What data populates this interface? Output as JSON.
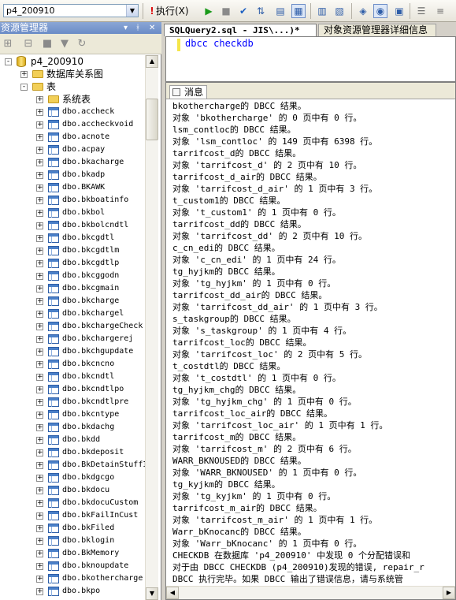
{
  "toolbar": {
    "database": "p4_200910",
    "execute_label": "执行(X)"
  },
  "object_explorer": {
    "title": "资源管理器",
    "pin": "▾ ╀ ✕",
    "nodes": [
      {
        "label": "p4_200910",
        "level": 0,
        "kind": "db",
        "exp": "-"
      },
      {
        "label": "数据库关系图",
        "level": 1,
        "kind": "folder",
        "exp": "+"
      },
      {
        "label": "表",
        "level": 1,
        "kind": "folder",
        "exp": "-"
      },
      {
        "label": "系统表",
        "level": 2,
        "kind": "folder",
        "exp": "+"
      },
      {
        "label": "dbo.accheck",
        "level": 2,
        "kind": "table",
        "exp": "+"
      },
      {
        "label": "dbo.accheckvoid",
        "level": 2,
        "kind": "table",
        "exp": "+"
      },
      {
        "label": "dbo.acnote",
        "level": 2,
        "kind": "table",
        "exp": "+"
      },
      {
        "label": "dbo.acpay",
        "level": 2,
        "kind": "table",
        "exp": "+"
      },
      {
        "label": "dbo.bkacharge",
        "level": 2,
        "kind": "table",
        "exp": "+"
      },
      {
        "label": "dbo.bkadp",
        "level": 2,
        "kind": "table",
        "exp": "+"
      },
      {
        "label": "dbo.BKAWK",
        "level": 2,
        "kind": "table",
        "exp": "+"
      },
      {
        "label": "dbo.bkboatinfo",
        "level": 2,
        "kind": "table",
        "exp": "+"
      },
      {
        "label": "dbo.bkbol",
        "level": 2,
        "kind": "table",
        "exp": "+"
      },
      {
        "label": "dbo.bkbolcndtl",
        "level": 2,
        "kind": "table",
        "exp": "+"
      },
      {
        "label": "dbo.bkcgdtl",
        "level": 2,
        "kind": "table",
        "exp": "+"
      },
      {
        "label": "dbo.bkcgdtlm",
        "level": 2,
        "kind": "table",
        "exp": "+"
      },
      {
        "label": "dbo.bkcgdtlp",
        "level": 2,
        "kind": "table",
        "exp": "+"
      },
      {
        "label": "dbo.bkcggodn",
        "level": 2,
        "kind": "table",
        "exp": "+"
      },
      {
        "label": "dbo.bkcgmain",
        "level": 2,
        "kind": "table",
        "exp": "+"
      },
      {
        "label": "dbo.bkcharge",
        "level": 2,
        "kind": "table",
        "exp": "+"
      },
      {
        "label": "dbo.bkchargel",
        "level": 2,
        "kind": "table",
        "exp": "+"
      },
      {
        "label": "dbo.bkchargeCheck",
        "level": 2,
        "kind": "table",
        "exp": "+"
      },
      {
        "label": "dbo.bkchargerej",
        "level": 2,
        "kind": "table",
        "exp": "+"
      },
      {
        "label": "dbo.bkchgupdate",
        "level": 2,
        "kind": "table",
        "exp": "+"
      },
      {
        "label": "dbo.bkcncno",
        "level": 2,
        "kind": "table",
        "exp": "+"
      },
      {
        "label": "dbo.bkcndtl",
        "level": 2,
        "kind": "table",
        "exp": "+"
      },
      {
        "label": "dbo.bkcndtlpo",
        "level": 2,
        "kind": "table",
        "exp": "+"
      },
      {
        "label": "dbo.bkcndtlpre",
        "level": 2,
        "kind": "table",
        "exp": "+"
      },
      {
        "label": "dbo.bkcntype",
        "level": 2,
        "kind": "table",
        "exp": "+"
      },
      {
        "label": "dbo.bkdachg",
        "level": 2,
        "kind": "table",
        "exp": "+"
      },
      {
        "label": "dbo.bkdd",
        "level": 2,
        "kind": "table",
        "exp": "+"
      },
      {
        "label": "dbo.bkdeposit",
        "level": 2,
        "kind": "table",
        "exp": "+"
      },
      {
        "label": "dbo.BkDetainStuffI",
        "level": 2,
        "kind": "table",
        "exp": "+"
      },
      {
        "label": "dbo.bkdgcgo",
        "level": 2,
        "kind": "table",
        "exp": "+"
      },
      {
        "label": "dbo.bkdocu",
        "level": 2,
        "kind": "table",
        "exp": "+"
      },
      {
        "label": "dbo.bkdocuCustom",
        "level": 2,
        "kind": "table",
        "exp": "+"
      },
      {
        "label": "dbo.bkFailInCust",
        "level": 2,
        "kind": "table",
        "exp": "+"
      },
      {
        "label": "dbo.bkFiled",
        "level": 2,
        "kind": "table",
        "exp": "+"
      },
      {
        "label": "dbo.bklogin",
        "level": 2,
        "kind": "table",
        "exp": "+"
      },
      {
        "label": "dbo.BkMemory",
        "level": 2,
        "kind": "table",
        "exp": "+"
      },
      {
        "label": "dbo.bknoupdate",
        "level": 2,
        "kind": "table",
        "exp": "+"
      },
      {
        "label": "dbo.bkothercharge",
        "level": 2,
        "kind": "table",
        "exp": "+"
      },
      {
        "label": "dbo.bkpo",
        "level": 2,
        "kind": "table",
        "exp": "+"
      }
    ]
  },
  "editor": {
    "tabs": [
      "SQLQuery2.sql - JIS\\...)*",
      "对象资源管理器详细信息"
    ],
    "code": "dbcc checkdb"
  },
  "results": {
    "tab_label": "消息",
    "messages": [
      "bkothercharge的 DBCC 结果。",
      "对象 'bkothercharge' 的 0 页中有 0 行。",
      "lsm_contloc的 DBCC 结果。",
      "对象 'lsm_contloc' 的 149 页中有 6398 行。",
      "tarrifcost_d的 DBCC 结果。",
      "对象 'tarrifcost_d' 的 2 页中有 10 行。",
      "tarrifcost_d_air的 DBCC 结果。",
      "对象 'tarrifcost_d_air' 的 1 页中有 3 行。",
      "t_custom1的 DBCC 结果。",
      "对象 't_custom1' 的 1 页中有 0 行。",
      "tarrifcost_dd的 DBCC 结果。",
      "对象 'tarrifcost_dd' 的 2 页中有 10 行。",
      "c_cn_edi的 DBCC 结果。",
      "对象 'c_cn_edi' 的 1 页中有 24 行。",
      "tg_hyjkm的 DBCC 结果。",
      "对象 'tg_hyjkm' 的 1 页中有 0 行。",
      "tarrifcost_dd_air的 DBCC 结果。",
      "对象 'tarrifcost_dd_air' 的 1 页中有 3 行。",
      "s_taskgroup的 DBCC 结果。",
      "对象 's_taskgroup' 的 1 页中有 4 行。",
      "tarrifcost_loc的 DBCC 结果。",
      "对象 'tarrifcost_loc' 的 2 页中有 5 行。",
      "t_costdtl的 DBCC 结果。",
      "对象 't_costdtl' 的 1 页中有 0 行。",
      "tg_hyjkm_chg的 DBCC 结果。",
      "对象 'tg_hyjkm_chg' 的 1 页中有 0 行。",
      "tarrifcost_loc_air的 DBCC 结果。",
      "对象 'tarrifcost_loc_air' 的 1 页中有 1 行。",
      "tarrifcost_m的 DBCC 结果。",
      "对象 'tarrifcost_m' 的 2 页中有 6 行。",
      "WARR_BKNOUSED的 DBCC 结果。",
      "对象 'WARR_BKNOUSED' 的 1 页中有 0 行。",
      "tg_kyjkm的 DBCC 结果。",
      "对象 'tg_kyjkm' 的 1 页中有 0 行。",
      "tarrifcost_m_air的 DBCC 结果。",
      "对象 'tarrifcost_m_air' 的 1 页中有 1 行。",
      "Warr_bKnocanc的 DBCC 结果。",
      "对象 'Warr_bKnocanc' 的 1 页中有 0 行。",
      "CHECKDB 在数据库 'p4_200910' 中发现 0 个分配错误和",
      "对于由 DBCC CHECKDB (p4_200910)发现的错误, repair_r",
      "DBCC 执行完毕。如果 DBCC 输出了错误信息，请与系统管"
    ]
  }
}
